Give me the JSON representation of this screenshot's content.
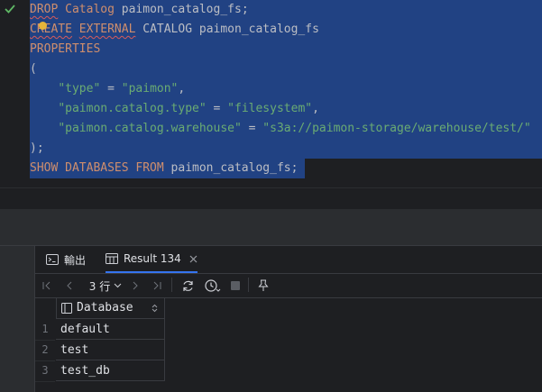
{
  "editor": {
    "lines": [
      {
        "segments": [
          {
            "t": "DROP",
            "c": "kw squig"
          },
          {
            "t": " ",
            "c": "pl"
          },
          {
            "t": "Catalog",
            "c": "kw"
          },
          {
            "t": " paimon_catalog_fs;",
            "c": "pl"
          }
        ]
      },
      {
        "segments": [
          {
            "t": "CREATE",
            "c": "kw squig"
          },
          {
            "t": " ",
            "c": "pl"
          },
          {
            "t": "EXTERNAL",
            "c": "kw squig"
          },
          {
            "t": " CATALOG paimon_catalog_fs",
            "c": "pl"
          }
        ]
      },
      {
        "segments": [
          {
            "t": "PROPERTIES",
            "c": "kw"
          }
        ]
      },
      {
        "segments": [
          {
            "t": "(",
            "c": "pl"
          }
        ]
      },
      {
        "segments": [
          {
            "t": "    ",
            "c": "pl"
          },
          {
            "t": "\"type\"",
            "c": "str"
          },
          {
            "t": " = ",
            "c": "pl"
          },
          {
            "t": "\"paimon\"",
            "c": "str"
          },
          {
            "t": ",",
            "c": "pl"
          }
        ]
      },
      {
        "segments": [
          {
            "t": "    ",
            "c": "pl"
          },
          {
            "t": "\"paimon.catalog.type\"",
            "c": "str"
          },
          {
            "t": " = ",
            "c": "pl"
          },
          {
            "t": "\"filesystem\"",
            "c": "str"
          },
          {
            "t": ",",
            "c": "pl"
          }
        ]
      },
      {
        "segments": [
          {
            "t": "    ",
            "c": "pl"
          },
          {
            "t": "\"paimon.catalog.warehouse\"",
            "c": "str"
          },
          {
            "t": " = ",
            "c": "pl"
          },
          {
            "t": "\"s3a://paimon-storage/warehouse/test/\"",
            "c": "str"
          }
        ]
      },
      {
        "segments": [
          {
            "t": ");",
            "c": "pl"
          }
        ]
      },
      {
        "segments": [
          {
            "t": "SHOW DATABASES FROM",
            "c": "kw"
          },
          {
            "t": " paimon_catalog_fs;",
            "c": "pl"
          }
        ]
      }
    ]
  },
  "tabs": {
    "output_label": "輸出",
    "result_label": "Result 134"
  },
  "toolbar": {
    "rows_label": "3 行"
  },
  "table": {
    "header": "Database",
    "rows": [
      {
        "num": "1",
        "value": "default"
      },
      {
        "num": "2",
        "value": "test"
      },
      {
        "num": "3",
        "value": "test_db"
      }
    ]
  }
}
